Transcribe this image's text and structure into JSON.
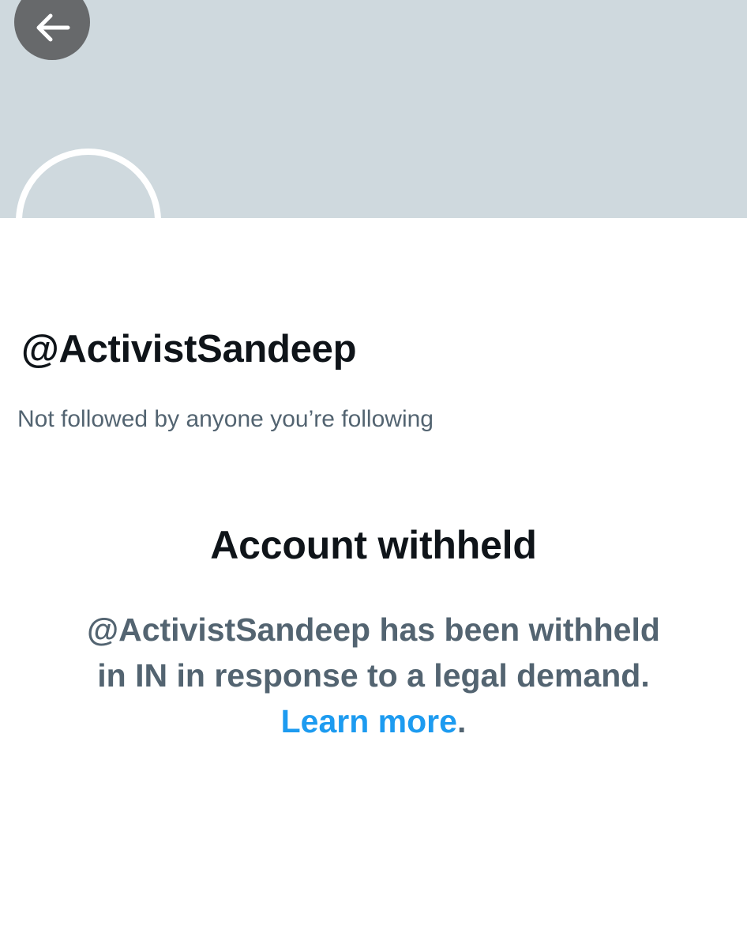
{
  "header": {
    "back_icon": "arrow-left-icon"
  },
  "profile": {
    "handle": "@ActivistSandeep",
    "follow_note": "Not followed by anyone you’re following"
  },
  "withheld": {
    "title": "Account withheld",
    "message_line1": "@ActivistSandeep has been withheld",
    "message_line2": "in IN in response to a legal demand.",
    "learn_more": "Learn more",
    "trailing": "."
  },
  "colors": {
    "banner": "#cfd9de",
    "back_button": "#67696b",
    "primary_text": "#0f1419",
    "secondary_text": "#536471",
    "link": "#1d9bf0"
  }
}
